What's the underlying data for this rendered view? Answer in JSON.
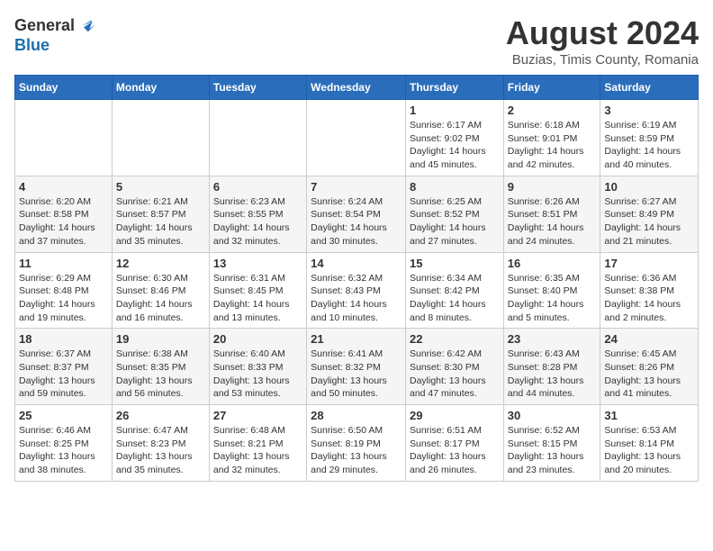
{
  "header": {
    "logo_general": "General",
    "logo_blue": "Blue",
    "title": "August 2024",
    "subtitle": "Buzias, Timis County, Romania"
  },
  "days_of_week": [
    "Sunday",
    "Monday",
    "Tuesday",
    "Wednesday",
    "Thursday",
    "Friday",
    "Saturday"
  ],
  "weeks": [
    [
      {
        "num": "",
        "info": ""
      },
      {
        "num": "",
        "info": ""
      },
      {
        "num": "",
        "info": ""
      },
      {
        "num": "",
        "info": ""
      },
      {
        "num": "1",
        "info": "Sunrise: 6:17 AM\nSunset: 9:02 PM\nDaylight: 14 hours and 45 minutes."
      },
      {
        "num": "2",
        "info": "Sunrise: 6:18 AM\nSunset: 9:01 PM\nDaylight: 14 hours and 42 minutes."
      },
      {
        "num": "3",
        "info": "Sunrise: 6:19 AM\nSunset: 8:59 PM\nDaylight: 14 hours and 40 minutes."
      }
    ],
    [
      {
        "num": "4",
        "info": "Sunrise: 6:20 AM\nSunset: 8:58 PM\nDaylight: 14 hours and 37 minutes."
      },
      {
        "num": "5",
        "info": "Sunrise: 6:21 AM\nSunset: 8:57 PM\nDaylight: 14 hours and 35 minutes."
      },
      {
        "num": "6",
        "info": "Sunrise: 6:23 AM\nSunset: 8:55 PM\nDaylight: 14 hours and 32 minutes."
      },
      {
        "num": "7",
        "info": "Sunrise: 6:24 AM\nSunset: 8:54 PM\nDaylight: 14 hours and 30 minutes."
      },
      {
        "num": "8",
        "info": "Sunrise: 6:25 AM\nSunset: 8:52 PM\nDaylight: 14 hours and 27 minutes."
      },
      {
        "num": "9",
        "info": "Sunrise: 6:26 AM\nSunset: 8:51 PM\nDaylight: 14 hours and 24 minutes."
      },
      {
        "num": "10",
        "info": "Sunrise: 6:27 AM\nSunset: 8:49 PM\nDaylight: 14 hours and 21 minutes."
      }
    ],
    [
      {
        "num": "11",
        "info": "Sunrise: 6:29 AM\nSunset: 8:48 PM\nDaylight: 14 hours and 19 minutes."
      },
      {
        "num": "12",
        "info": "Sunrise: 6:30 AM\nSunset: 8:46 PM\nDaylight: 14 hours and 16 minutes."
      },
      {
        "num": "13",
        "info": "Sunrise: 6:31 AM\nSunset: 8:45 PM\nDaylight: 14 hours and 13 minutes."
      },
      {
        "num": "14",
        "info": "Sunrise: 6:32 AM\nSunset: 8:43 PM\nDaylight: 14 hours and 10 minutes."
      },
      {
        "num": "15",
        "info": "Sunrise: 6:34 AM\nSunset: 8:42 PM\nDaylight: 14 hours and 8 minutes."
      },
      {
        "num": "16",
        "info": "Sunrise: 6:35 AM\nSunset: 8:40 PM\nDaylight: 14 hours and 5 minutes."
      },
      {
        "num": "17",
        "info": "Sunrise: 6:36 AM\nSunset: 8:38 PM\nDaylight: 14 hours and 2 minutes."
      }
    ],
    [
      {
        "num": "18",
        "info": "Sunrise: 6:37 AM\nSunset: 8:37 PM\nDaylight: 13 hours and 59 minutes."
      },
      {
        "num": "19",
        "info": "Sunrise: 6:38 AM\nSunset: 8:35 PM\nDaylight: 13 hours and 56 minutes."
      },
      {
        "num": "20",
        "info": "Sunrise: 6:40 AM\nSunset: 8:33 PM\nDaylight: 13 hours and 53 minutes."
      },
      {
        "num": "21",
        "info": "Sunrise: 6:41 AM\nSunset: 8:32 PM\nDaylight: 13 hours and 50 minutes."
      },
      {
        "num": "22",
        "info": "Sunrise: 6:42 AM\nSunset: 8:30 PM\nDaylight: 13 hours and 47 minutes."
      },
      {
        "num": "23",
        "info": "Sunrise: 6:43 AM\nSunset: 8:28 PM\nDaylight: 13 hours and 44 minutes."
      },
      {
        "num": "24",
        "info": "Sunrise: 6:45 AM\nSunset: 8:26 PM\nDaylight: 13 hours and 41 minutes."
      }
    ],
    [
      {
        "num": "25",
        "info": "Sunrise: 6:46 AM\nSunset: 8:25 PM\nDaylight: 13 hours and 38 minutes."
      },
      {
        "num": "26",
        "info": "Sunrise: 6:47 AM\nSunset: 8:23 PM\nDaylight: 13 hours and 35 minutes."
      },
      {
        "num": "27",
        "info": "Sunrise: 6:48 AM\nSunset: 8:21 PM\nDaylight: 13 hours and 32 minutes."
      },
      {
        "num": "28",
        "info": "Sunrise: 6:50 AM\nSunset: 8:19 PM\nDaylight: 13 hours and 29 minutes."
      },
      {
        "num": "29",
        "info": "Sunrise: 6:51 AM\nSunset: 8:17 PM\nDaylight: 13 hours and 26 minutes."
      },
      {
        "num": "30",
        "info": "Sunrise: 6:52 AM\nSunset: 8:15 PM\nDaylight: 13 hours and 23 minutes."
      },
      {
        "num": "31",
        "info": "Sunrise: 6:53 AM\nSunset: 8:14 PM\nDaylight: 13 hours and 20 minutes."
      }
    ]
  ]
}
